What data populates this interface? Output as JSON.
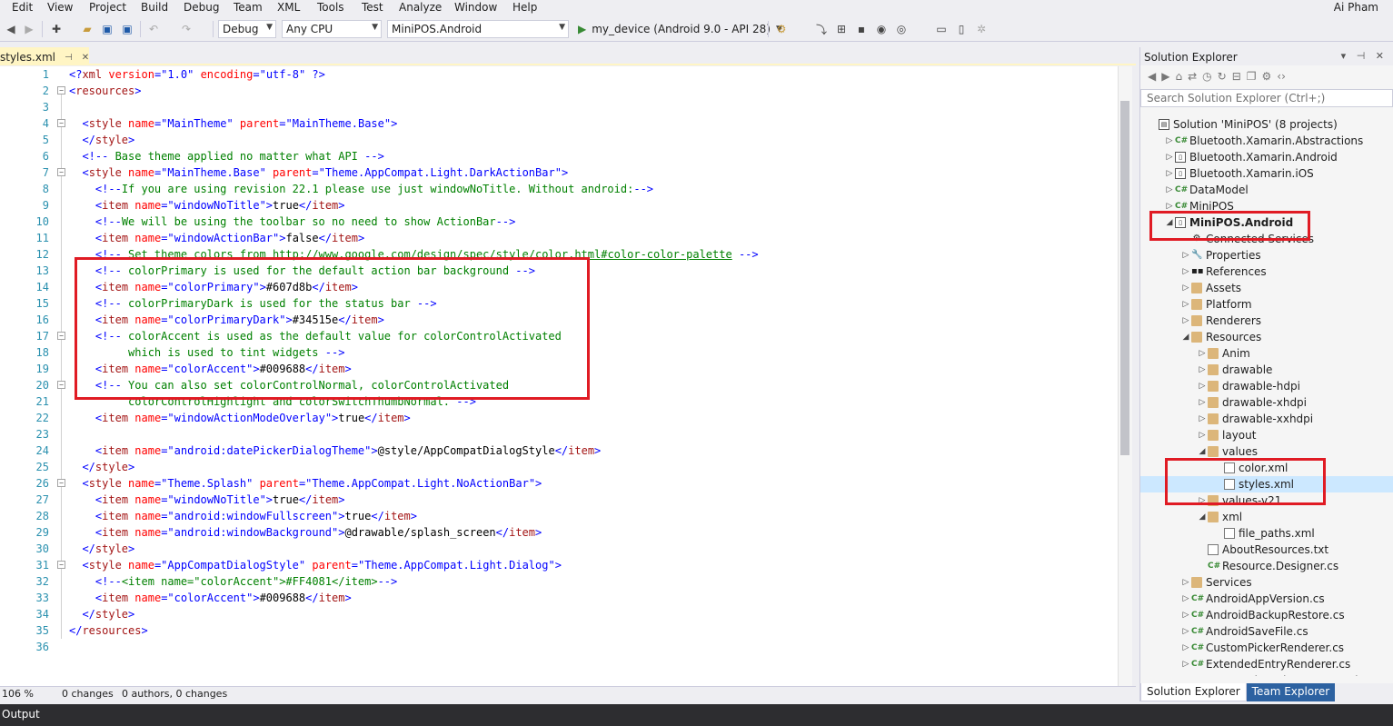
{
  "menu": [
    "Edit",
    "View",
    "Project",
    "Build",
    "Debug",
    "Team",
    "XML",
    "Tools",
    "Test",
    "Analyze",
    "Window",
    "Help"
  ],
  "user": "Ai Pham",
  "toolbar": {
    "config": "Debug",
    "platform": "Any CPU",
    "project": "MiniPOS.Android",
    "device": "my_device (Android 9.0 - API 28)"
  },
  "tab": {
    "title": "styles.xml"
  },
  "editor": {
    "line_numbers": [
      "1",
      "2",
      "3",
      "4",
      "5",
      "6",
      "7",
      "8",
      "9",
      "10",
      "11",
      "12",
      "13",
      "14",
      "15",
      "16",
      "17",
      "18",
      "19",
      "20",
      "21",
      "22",
      "23",
      "24",
      "25",
      "26",
      "27",
      "28",
      "29",
      "30",
      "31",
      "32",
      "33",
      "34",
      "35",
      "36"
    ]
  },
  "status": {
    "zoom": "106 %",
    "changes": "0 changes",
    "authors": "0 authors, 0 changes"
  },
  "output": {
    "label": "Output"
  },
  "solution_explorer": {
    "title": "Solution Explorer",
    "search_placeholder": "Search Solution Explorer (Ctrl+;)",
    "nodes": [
      {
        "label": "Solution 'MiniPOS' (8 projects)",
        "depth": 0,
        "icon": "solution",
        "exp": ""
      },
      {
        "label": "Bluetooth.Xamarin.Abstractions",
        "depth": 1,
        "icon": "csproj",
        "exp": "▷"
      },
      {
        "label": "Bluetooth.Xamarin.Android",
        "depth": 1,
        "icon": "androidproj",
        "exp": "▷"
      },
      {
        "label": "Bluetooth.Xamarin.iOS",
        "depth": 1,
        "icon": "iosproj",
        "exp": "▷"
      },
      {
        "label": "DataModel",
        "depth": 1,
        "icon": "csproj",
        "exp": "▷"
      },
      {
        "label": "MiniPOS",
        "depth": 1,
        "icon": "csproj",
        "exp": "▷"
      },
      {
        "label": "MiniPOS.Android",
        "depth": 1,
        "icon": "androidproj",
        "exp": "◢",
        "bold": true
      },
      {
        "label": "Connected Services",
        "depth": 2,
        "icon": "services",
        "exp": ""
      },
      {
        "label": "Properties",
        "depth": 2,
        "icon": "wrench",
        "exp": "▷"
      },
      {
        "label": "References",
        "depth": 2,
        "icon": "refs",
        "exp": "▷"
      },
      {
        "label": "Assets",
        "depth": 2,
        "icon": "folder",
        "exp": "▷"
      },
      {
        "label": "Platform",
        "depth": 2,
        "icon": "folder",
        "exp": "▷"
      },
      {
        "label": "Renderers",
        "depth": 2,
        "icon": "folder",
        "exp": "▷"
      },
      {
        "label": "Resources",
        "depth": 2,
        "icon": "folder",
        "exp": "◢"
      },
      {
        "label": "Anim",
        "depth": 3,
        "icon": "folder",
        "exp": "▷"
      },
      {
        "label": "drawable",
        "depth": 3,
        "icon": "folder",
        "exp": "▷"
      },
      {
        "label": "drawable-hdpi",
        "depth": 3,
        "icon": "folder",
        "exp": "▷"
      },
      {
        "label": "drawable-xhdpi",
        "depth": 3,
        "icon": "folder",
        "exp": "▷"
      },
      {
        "label": "drawable-xxhdpi",
        "depth": 3,
        "icon": "folder",
        "exp": "▷"
      },
      {
        "label": "layout",
        "depth": 3,
        "icon": "folder",
        "exp": "▷"
      },
      {
        "label": "values",
        "depth": 3,
        "icon": "folder",
        "exp": "◢"
      },
      {
        "label": "color.xml",
        "depth": 4,
        "icon": "file",
        "exp": ""
      },
      {
        "label": "styles.xml",
        "depth": 4,
        "icon": "file",
        "exp": "",
        "selected": true
      },
      {
        "label": "values-v21",
        "depth": 3,
        "icon": "folder",
        "exp": "▷"
      },
      {
        "label": "xml",
        "depth": 3,
        "icon": "folder",
        "exp": "◢"
      },
      {
        "label": "file_paths.xml",
        "depth": 4,
        "icon": "file",
        "exp": ""
      },
      {
        "label": "AboutResources.txt",
        "depth": 3,
        "icon": "file",
        "exp": ""
      },
      {
        "label": "Resource.Designer.cs",
        "depth": 3,
        "icon": "cs",
        "exp": ""
      },
      {
        "label": "Services",
        "depth": 2,
        "icon": "folder",
        "exp": "▷"
      },
      {
        "label": "AndroidAppVersion.cs",
        "depth": 2,
        "icon": "cs",
        "exp": "▷"
      },
      {
        "label": "AndroidBackupRestore.cs",
        "depth": 2,
        "icon": "cs",
        "exp": "▷"
      },
      {
        "label": "AndroidSaveFile.cs",
        "depth": 2,
        "icon": "cs",
        "exp": "▷"
      },
      {
        "label": "CustomPickerRenderer.cs",
        "depth": 2,
        "icon": "cs",
        "exp": "▷"
      },
      {
        "label": "ExtendedEntryRenderer.cs",
        "depth": 2,
        "icon": "cs",
        "exp": "▷"
      },
      {
        "label": "FormattedNumberEntryRenderer.cs",
        "depth": 2,
        "icon": "cs",
        "exp": "▷"
      }
    ],
    "tabs": [
      "Solution Explorer",
      "Team Explorer"
    ]
  },
  "colors": {
    "annotation": "#e01b24",
    "selection": "#cce8ff",
    "tab": "#fff5c4"
  }
}
